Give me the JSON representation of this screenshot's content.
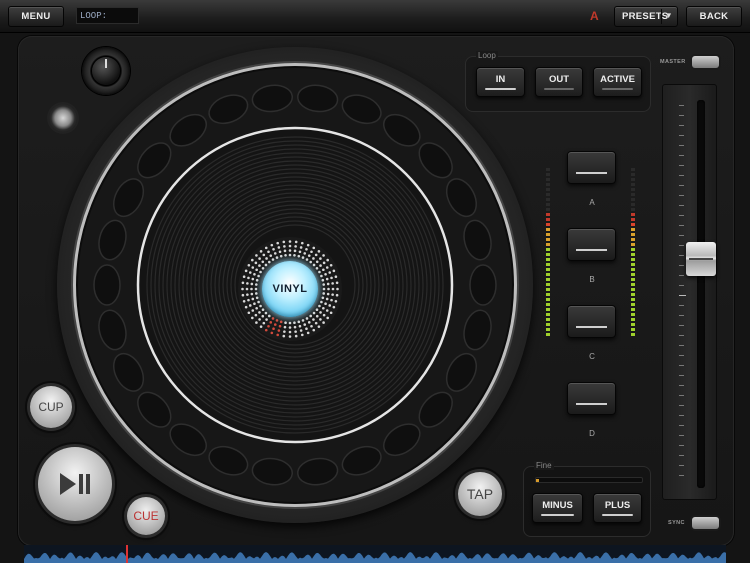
{
  "topbar": {
    "menu_label": "MENU",
    "loop_display": "LOOP:",
    "indicator": "A",
    "presets_label": "PRESETS",
    "presets_arrow": "▼",
    "back_label": "BACK"
  },
  "deck": {
    "vinyl_label": "VINYL",
    "cup_label": "CUP",
    "cue_label": "CUE",
    "tap_label": "TAP"
  },
  "loop": {
    "title": "Loop",
    "in_label": "IN",
    "out_label": "OUT",
    "active_label": "ACTIVE"
  },
  "pads": {
    "a": "A",
    "b": "B",
    "c": "C",
    "d": "D"
  },
  "fine": {
    "title": "Fine",
    "minus_label": "MINUS",
    "plus_label": "PLUS"
  },
  "fader": {
    "master_label": "MASTER",
    "sync_label": "SYNC"
  },
  "colors": {
    "vinyl_glow": "#5cc7f0",
    "cue_text": "#b33333",
    "indicator": "#c0392b",
    "playhead": "#dd3333",
    "waveform": "#3a6fa8"
  }
}
